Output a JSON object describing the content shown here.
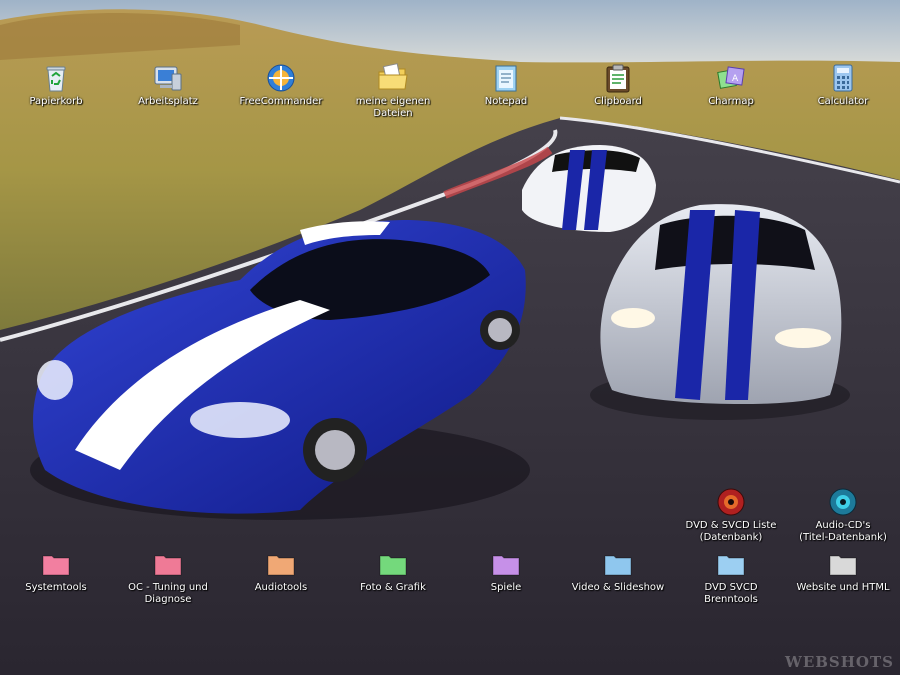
{
  "desktop": {
    "icons": [
      {
        "label": "Papierkorb",
        "icon": "recycle-bin-icon"
      },
      {
        "label": "Arbeitsplatz",
        "icon": "my-computer-icon"
      },
      {
        "label": "FreeCommander",
        "icon": "freecommander-icon"
      },
      {
        "label": "meine eigenen\nDateien",
        "icon": "my-documents-icon"
      },
      {
        "label": "Notepad",
        "icon": "notepad-icon"
      },
      {
        "label": "Clipboard",
        "icon": "clipboard-icon"
      },
      {
        "label": "Charmap",
        "icon": "charmap-icon"
      },
      {
        "label": "Calculator",
        "icon": "calculator-icon"
      },
      {
        "label": "DVD & SVCD Liste\n(Datenbank)",
        "icon": "dvd-database-icon"
      },
      {
        "label": "Audio-CD's\n(Titel-Datenbank)",
        "icon": "audio-cd-database-icon"
      },
      {
        "label": "Systemtools",
        "icon": "folder-icon",
        "color": "#f27fa0"
      },
      {
        "label": "OC - Tuning und\nDiagnose",
        "icon": "folder-icon",
        "color": "#ef7a96"
      },
      {
        "label": "Audiotools",
        "icon": "folder-icon",
        "color": "#f0a875"
      },
      {
        "label": "Foto & Grafik",
        "icon": "folder-icon",
        "color": "#74d97c"
      },
      {
        "label": "Spiele",
        "icon": "folder-icon",
        "color": "#c690e8"
      },
      {
        "label": "Video & Slideshow",
        "icon": "folder-icon",
        "color": "#8fc7ee"
      },
      {
        "label": "DVD SVCD Brenntools",
        "icon": "folder-icon",
        "color": "#9ccff2"
      },
      {
        "label": "Website und HTML",
        "icon": "folder-icon",
        "color": "#d9d9d9"
      }
    ]
  },
  "wallpaper": {
    "watermark": "WEBSHOTS",
    "sky_color": "#b9c9d8",
    "grass_color": "#b59a55",
    "road_color": "#3a3a44",
    "car_blue": "#1f2fb4",
    "car_silver": "#c8ccd6"
  }
}
